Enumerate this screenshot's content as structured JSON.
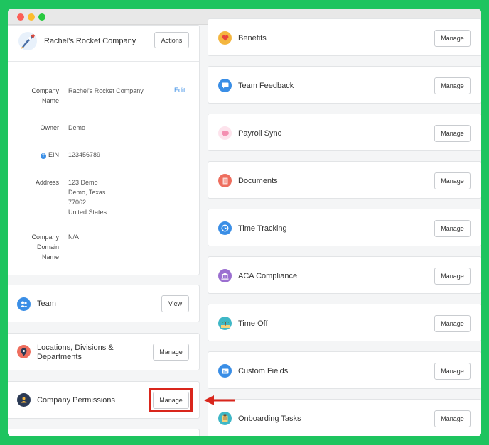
{
  "window": {
    "controls": [
      "close",
      "minimize",
      "zoom"
    ]
  },
  "company": {
    "name": "Rachel's Rocket Company",
    "actions_label": "Actions",
    "edit_label": "Edit",
    "fields": {
      "company_name": {
        "label_line1": "Company",
        "label_line2": "Name",
        "value": "Rachel's Rocket Company"
      },
      "owner": {
        "label": "Owner",
        "value": "Demo"
      },
      "ein": {
        "label": "EIN",
        "value": "123456789"
      },
      "address": {
        "label": "Address",
        "line1": "123 Demo",
        "line2": "Demo, Texas",
        "line3": "77062",
        "line4": "United States"
      },
      "domain": {
        "label_line1": "Company",
        "label_line2": "Domain",
        "label_line3": "Name",
        "value": "N/A"
      }
    }
  },
  "left_sections": {
    "team": {
      "title": "Team",
      "button": "View",
      "icon": "team-icon"
    },
    "locations": {
      "title_line1": "Locations, Divisions &",
      "title_line2": "Departments",
      "button": "Manage",
      "icon": "location-pin-icon"
    },
    "permissions": {
      "title": "Company Permissions",
      "button": "Manage",
      "icon": "permissions-icon"
    }
  },
  "apps": [
    {
      "title": "Benefits",
      "button": "Manage",
      "icon": "heart-icon",
      "color": "#f4b63f"
    },
    {
      "title": "Team Feedback",
      "button": "Manage",
      "icon": "feedback-icon",
      "color": "#3a8ee6"
    },
    {
      "title": "Payroll Sync",
      "button": "Manage",
      "icon": "piggy-bank-icon",
      "color": "#f6a5c0"
    },
    {
      "title": "Documents",
      "button": "Manage",
      "icon": "document-icon",
      "color": "#ee6e5e"
    },
    {
      "title": "Time Tracking",
      "button": "Manage",
      "icon": "clock-icon",
      "color": "#3a8ee6"
    },
    {
      "title": "ACA Compliance",
      "button": "Manage",
      "icon": "building-icon",
      "color": "#9b6fd0"
    },
    {
      "title": "Time Off",
      "button": "Manage",
      "icon": "beach-icon",
      "color": "#3fb7c6"
    },
    {
      "title": "Custom Fields",
      "button": "Manage",
      "icon": "custom-fields-icon",
      "color": "#3a8ee6"
    },
    {
      "title": "Onboarding Tasks",
      "button": "Manage",
      "icon": "clipboard-icon",
      "color": "#3fb7c6"
    }
  ],
  "annotation": {
    "highlight_color": "#d9261c"
  }
}
